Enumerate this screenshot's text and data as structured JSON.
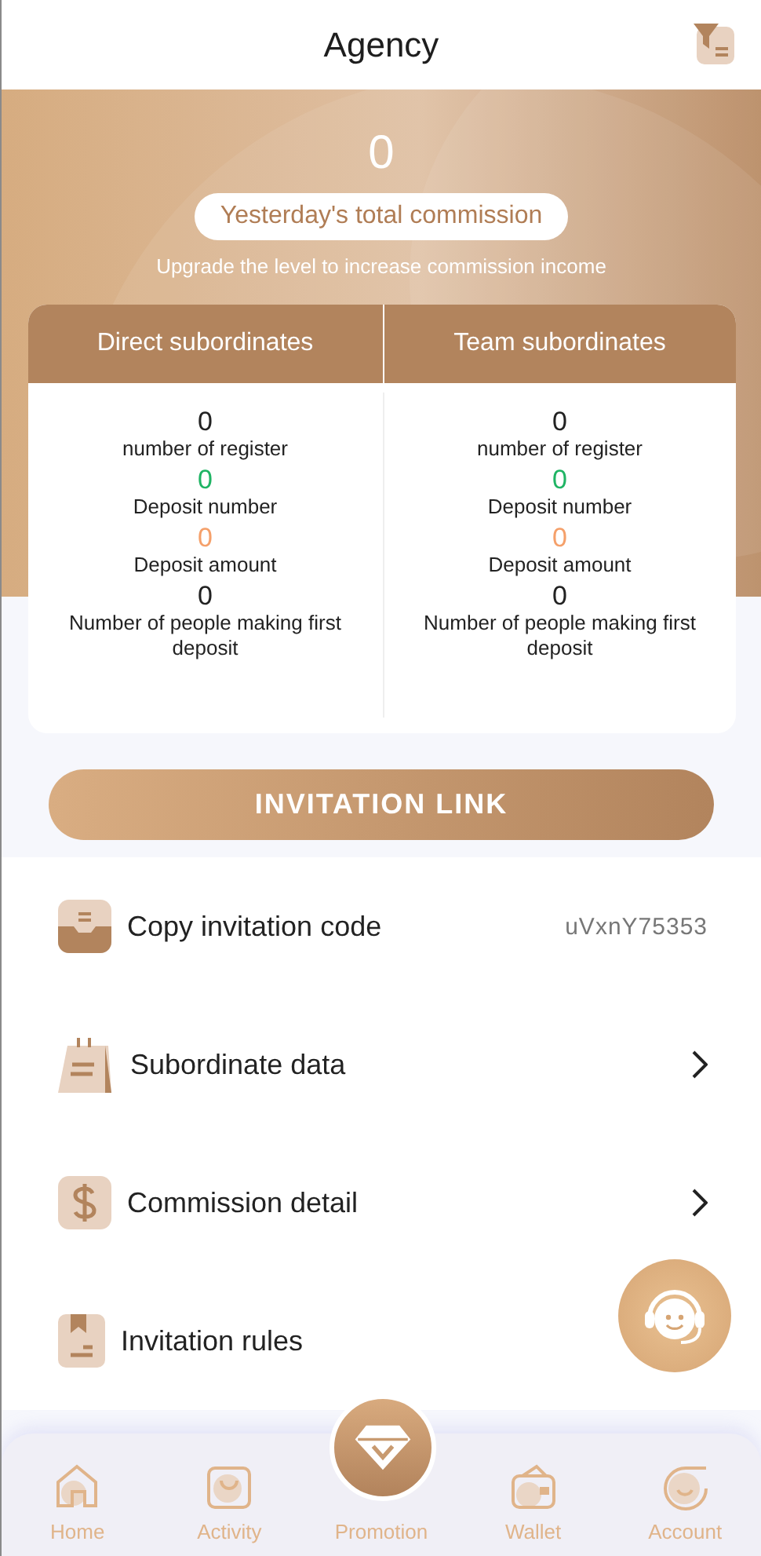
{
  "header": {
    "title": "Agency"
  },
  "summary": {
    "amount": "0",
    "label": "Yesterday's total commission",
    "note": "Upgrade the level to increase commission income"
  },
  "columns": [
    {
      "title": "Direct subordinates",
      "stats": [
        {
          "value": "0",
          "label": "number of register",
          "color": "#222222"
        },
        {
          "value": "0",
          "label": "Deposit number",
          "color": "#1fb464"
        },
        {
          "value": "0",
          "label": "Deposit amount",
          "color": "#f5a06a"
        },
        {
          "value": "0",
          "label": "Number of people making first deposit",
          "color": "#222222"
        }
      ]
    },
    {
      "title": "Team subordinates",
      "stats": [
        {
          "value": "0",
          "label": "number of register",
          "color": "#222222"
        },
        {
          "value": "0",
          "label": "Deposit number",
          "color": "#1fb464"
        },
        {
          "value": "0",
          "label": "Deposit amount",
          "color": "#f5a06a"
        },
        {
          "value": "0",
          "label": "Number of people making first deposit",
          "color": "#222222"
        }
      ]
    }
  ],
  "invite_button": "INVITATION LINK",
  "menu": [
    {
      "kind": "code",
      "label": "Copy invitation code",
      "value": "uVxnY75353"
    },
    {
      "kind": "link",
      "label": "Subordinate data"
    },
    {
      "kind": "link",
      "label": "Commission detail"
    },
    {
      "kind": "plain",
      "label": "Invitation rules"
    }
  ],
  "nav": [
    {
      "kind": "tab",
      "label": "Home"
    },
    {
      "kind": "tab",
      "label": "Activity"
    },
    {
      "kind": "center",
      "label": "Promotion"
    },
    {
      "kind": "tab",
      "label": "Wallet"
    },
    {
      "kind": "tab",
      "label": "Account"
    }
  ]
}
